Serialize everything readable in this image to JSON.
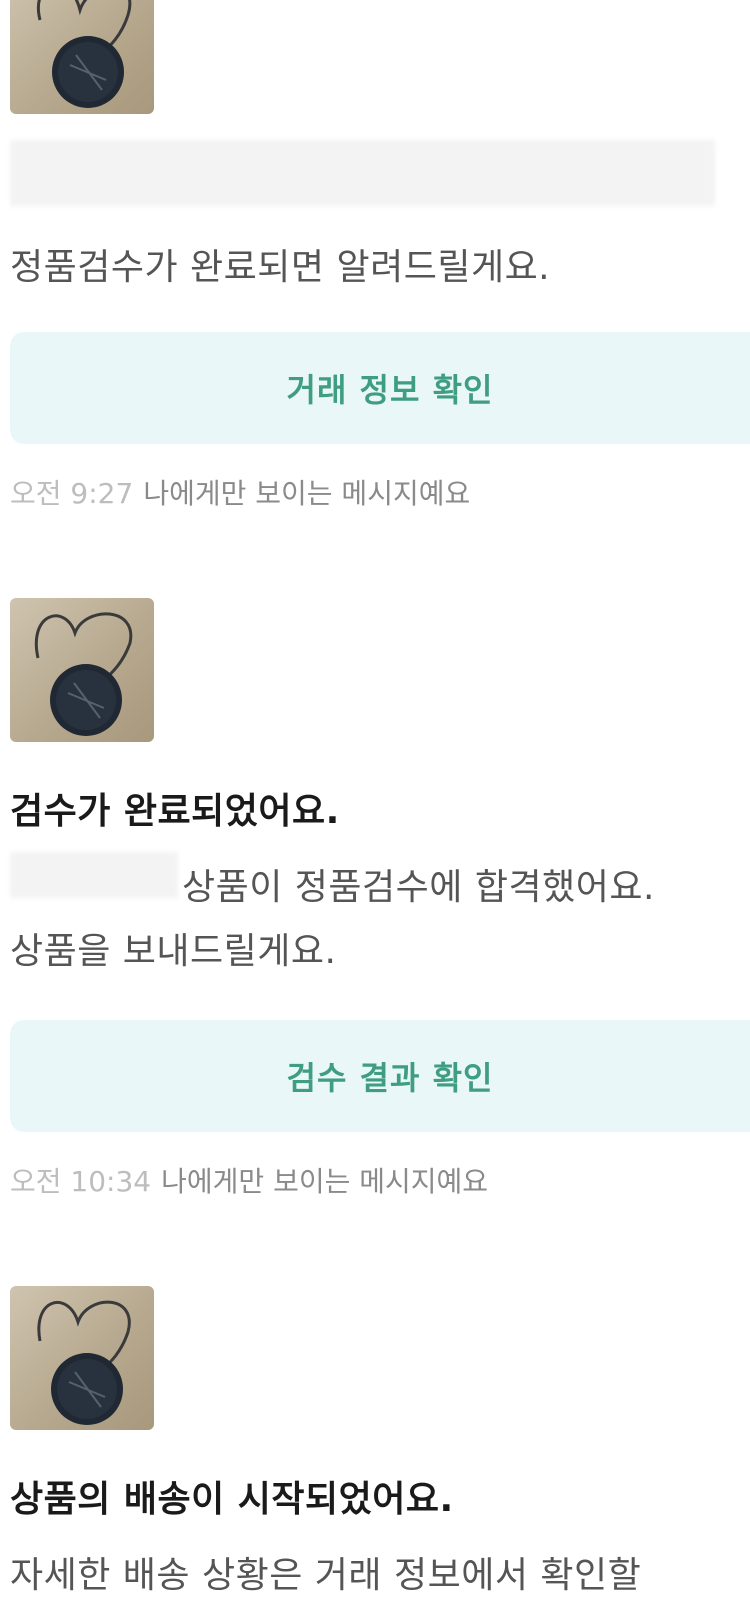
{
  "messages": [
    {
      "thumbnail": "product-thumbnail",
      "body_lines": [
        "정품검수가 완료되면 알려드릴게요."
      ],
      "button_label": "거래 정보 확인",
      "time": "오전 9:27",
      "note": "나에게만 보이는 메시지예요"
    },
    {
      "thumbnail": "product-thumbnail",
      "title": "검수가 완료되었어요.",
      "body_lines": [
        "상품이 정품검수에 합격했어요.",
        "상품을 보내드릴게요."
      ],
      "button_label": "검수 결과 확인",
      "time": "오전 10:34",
      "note": "나에게만 보이는 메시지예요"
    },
    {
      "thumbnail": "product-thumbnail",
      "title": "상품의 배송이 시작되었어요.",
      "body_lines": [
        "자세한 배송 상황은 거래 정보에서 확인할"
      ]
    }
  ],
  "colors": {
    "button_bg": "#e9f7f8",
    "button_text": "#3f9e82",
    "meta_time": "#bdbdbd",
    "meta_note": "#8a8a8a"
  }
}
